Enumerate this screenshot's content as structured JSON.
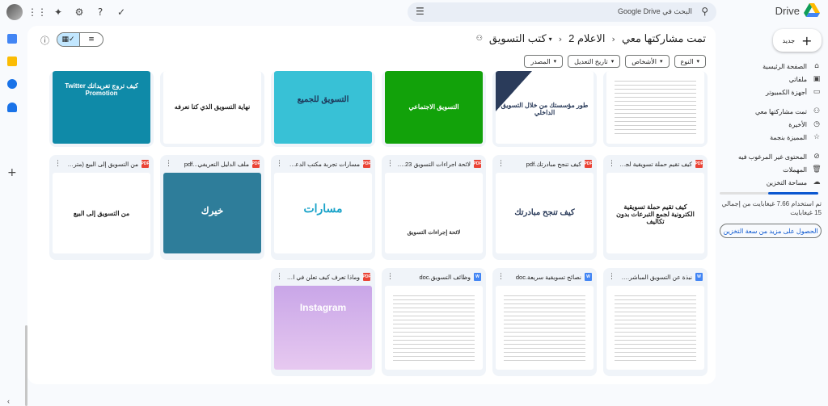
{
  "brand": {
    "name": "Drive"
  },
  "search": {
    "placeholder": "البحث في Google Drive"
  },
  "topbar": {
    "icons": [
      "avatar",
      "apps-grid-icon",
      "gemini-icon",
      "gear-icon",
      "help-icon",
      "check-circle-icon"
    ]
  },
  "breadcrumb": {
    "items": [
      "تمت مشاركتها معي",
      "الاعلام 2",
      "كتب التسويق"
    ]
  },
  "filters": [
    "النوع",
    "الأشخاص",
    "تاريخ التعديل",
    "المصدر"
  ],
  "sidebar": {
    "new_label": "جديد",
    "items": [
      {
        "label": "الصفحة الرئيسية",
        "icon": "home-icon"
      },
      {
        "label": "ملفاتي",
        "icon": "drive-icon"
      },
      {
        "label": "أجهزة الكمبيوتر",
        "icon": "computer-icon"
      },
      {
        "label": "تمت مشاركتها معي",
        "icon": "people-icon"
      },
      {
        "label": "الأخيرة",
        "icon": "clock-icon"
      },
      {
        "label": "المميزة بنجمة",
        "icon": "star-icon"
      },
      {
        "label": "المحتوى غير المرغوب فيه",
        "icon": "spam-icon"
      },
      {
        "label": "المهملات",
        "icon": "trash-icon"
      },
      {
        "label": "مساحة التخزين",
        "icon": "cloud-icon"
      }
    ],
    "storage_used_fraction": 0.51,
    "storage_text": "تم استخدام 7.66 غيغابايت من إجمالي 15 غيغابايت",
    "storage_button": "الحصول على مزيد من سعة التخزين"
  },
  "files": {
    "row1": [
      {
        "thumb": "",
        "color": "#ffffff"
      },
      {
        "thumb": "طور مؤسستك من خلال التسويق الداخلي",
        "color": "#ffffff"
      },
      {
        "thumb": "التسويق الاجتماعي",
        "color": "#12a20a"
      },
      {
        "thumb": "التسويق للجميع",
        "color": "#38c1d6"
      },
      {
        "thumb": "نهاية التسويق الذي كنا نعرفه",
        "color": "#ffffff"
      },
      {
        "thumb": "كيف تروج تغريداتك Twitter Promotion",
        "color": "#0f8aa8"
      }
    ],
    "row2": [
      {
        "title": "كيف تقيم حملة تسويقية لجذب...",
        "type": "PDF",
        "thumb": "كيف تقيم حملة تسويقية الكترونية لجمع التبرعات بدون تكاليف"
      },
      {
        "title": "كيف تنجح مبادرتك.pdf",
        "type": "PDF",
        "thumb": "كيف تنجح مبادرتك"
      },
      {
        "title": "لائحة اجراءات التسويق 23.pdf",
        "type": "PDF",
        "thumb": "لائحة إجراءات التسويق"
      },
      {
        "title": "مسارات تجربة مكتب الدعوة...",
        "type": "PDF",
        "thumb": "مسارات"
      },
      {
        "title": "ملف الدليل التعريفي...pdf",
        "type": "PDF",
        "thumb": "خيرك"
      },
      {
        "title": "من التسويق إلى البيع (مترجم).pdf",
        "type": "PDF",
        "thumb": "من التسويق إلى البيع"
      }
    ],
    "row3": [
      {
        "title": "نبذة عن التسويق المباشر.doc",
        "type": "W",
        "thumb": ""
      },
      {
        "title": "نصائح تسويقية سريعة.doc",
        "type": "W",
        "thumb": ""
      },
      {
        "title": "وظائف التسويق.doc",
        "type": "W",
        "thumb": ""
      },
      {
        "title": "وماذا تعرف كيف تعلن في الانستغرام",
        "type": "PDF",
        "thumb": "Instagram"
      }
    ]
  }
}
